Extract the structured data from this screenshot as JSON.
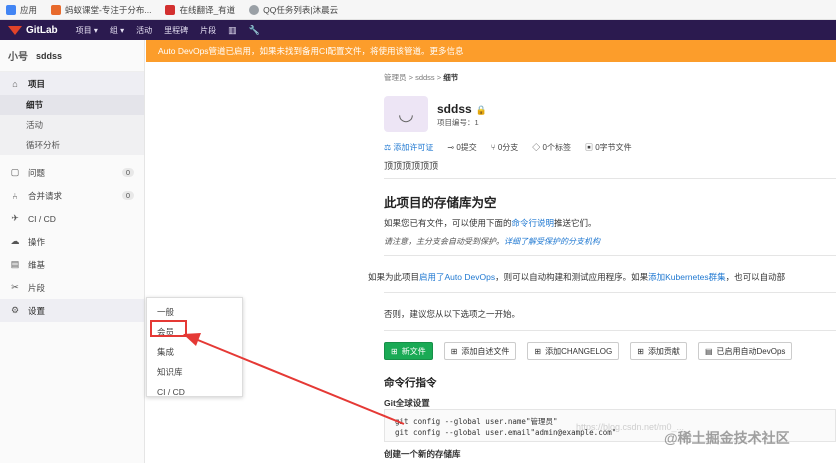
{
  "bookmarks": [
    {
      "label": "应用",
      "icon": "apps-icon",
      "color": "#4285f4"
    },
    {
      "label": "蚂蚁课堂-专注于分布...",
      "icon": "mayi-icon",
      "color": "#e86a2c"
    },
    {
      "label": "在线翻译_有道",
      "icon": "youdao-icon",
      "color": "#d3302f"
    },
    {
      "label": "QQ任务列表|沐晨云",
      "icon": "qq-icon",
      "color": "#9aa0a6"
    }
  ],
  "navbar": {
    "brand": "GitLab",
    "items": [
      "项目 ▾",
      "组 ▾",
      "活动",
      "里程碑",
      "片段"
    ],
    "icons": [
      "chart-icon",
      "wrench-icon"
    ]
  },
  "sidebar": {
    "project_avatar": "小号",
    "project_name": "sddss",
    "items": [
      {
        "label": "项目",
        "icon": "home-icon",
        "active": true
      },
      {
        "label": "问题",
        "icon": "issues-icon",
        "badge": "0"
      },
      {
        "label": "合并请求",
        "icon": "merge-icon",
        "badge": "0"
      },
      {
        "label": "CI / CD",
        "icon": "rocket-icon"
      },
      {
        "label": "操作",
        "icon": "cloud-icon"
      },
      {
        "label": "维基",
        "icon": "book-icon"
      },
      {
        "label": "片段",
        "icon": "scissors-icon"
      },
      {
        "label": "设置",
        "icon": "gear-icon"
      }
    ],
    "subitems": [
      {
        "label": "细节",
        "active": true
      },
      {
        "label": "活动"
      },
      {
        "label": "循环分析"
      }
    ]
  },
  "flyout": {
    "items": [
      "一般",
      "会员",
      "集成",
      "知识库",
      "CI / CD"
    ]
  },
  "banner": "Auto DevOps管道已启用，如果未找到备用CI配置文件，将使用该管道。更多信息",
  "breadcrumb": {
    "a": "管理员",
    "b": "sddss",
    "c": "细节",
    "sep": ">"
  },
  "project": {
    "avatar_glyph": "◡",
    "name": "sddss",
    "lock": "🔒",
    "id_label": "项目编号：1",
    "description": "顶顶顶顶顶顶"
  },
  "stats": [
    {
      "label": "添加许可证",
      "icon": "license-icon",
      "link": true
    },
    {
      "label": "0提交",
      "icon": "commit-icon"
    },
    {
      "label": "0分支",
      "icon": "branch-icon"
    },
    {
      "label": "0个标签",
      "icon": "tag-icon"
    },
    {
      "label": "0字节文件",
      "icon": "file-icon"
    }
  ],
  "empty": {
    "heading": "此项目的存储库为空",
    "p1_pre": "如果您已有文件，可以使用下面的",
    "p1_link": "命令行说明",
    "p1_post": "推送它们。",
    "p2_pre": "请注意，主分支会自动受到保护。",
    "p2_link": "详细了解受保护的分支机构",
    "p3_pre": "如果为此项目",
    "p3_link1": "启用了Auto DevOps",
    "p3_mid": "，则可以自动构建和测试应用程序。如果",
    "p3_link2": "添加Kubernetes群集",
    "p3_post": "，也可以自动部",
    "p4": "否则，建议您从以下选项之一开始。"
  },
  "buttons": [
    {
      "label": "新文件",
      "icon": "plus-icon",
      "primary": true
    },
    {
      "label": "添加自述文件",
      "icon": "plus-icon"
    },
    {
      "label": "添加CHANGELOG",
      "icon": "plus-icon"
    },
    {
      "label": "添加贡献",
      "icon": "plus-icon"
    },
    {
      "label": "已启用自动DevOps",
      "icon": "doc-icon"
    }
  ],
  "cli": {
    "heading": "命令行指令",
    "git_setup": "Git全球设置",
    "code": "git config --global user.name\"管理员\"\ngit config --global user.email\"admin@example.com\"",
    "new_repo": "创建一个新的存储库"
  },
  "watermark": "https://blog.csdn.net/m0_...",
  "wm_logo": "@稀土掘金技术社区",
  "colors": {
    "nav": "#2b1a4f",
    "banner": "#fc9d2b",
    "link": "#1f78d1",
    "green": "#1aaa55",
    "annotation": "#e53935"
  }
}
